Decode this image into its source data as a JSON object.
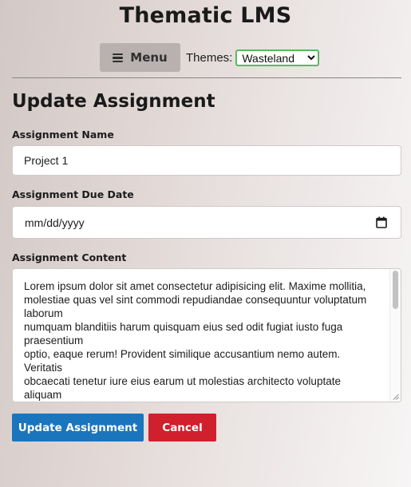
{
  "app": {
    "title": "Thematic LMS"
  },
  "nav": {
    "menu_label": "Menu",
    "menu_icon": "hamburger-icon",
    "themes_label": "Themes:",
    "themes_selected": "Wasteland",
    "themes_select_border_color": "#5cb85c"
  },
  "page": {
    "title": "Update Assignment"
  },
  "form": {
    "name_label": "Assignment Name",
    "name_value": "Project 1",
    "due_date_label": "Assignment Due Date",
    "due_date_placeholder": "mm/dd/yyyy",
    "due_date_icon": "calendar-icon",
    "content_label": "Assignment Content",
    "content_value": "Lorem ipsum dolor sit amet consectetur adipisicing elit. Maxime mollitia,\nmolestiae quas vel sint commodi repudiandae consequuntur voluptatum laborum\nnumquam blanditiis harum quisquam eius sed odit fugiat iusto fuga praesentium\noptio, eaque rerum! Provident similique accusantium nemo autem. Veritatis\nobcaecati tenetur iure eius earum ut molestias architecto voluptate aliquam"
  },
  "actions": {
    "update_label": "Update Assignment",
    "update_color": "#1a75bd",
    "cancel_label": "Cancel",
    "cancel_color": "#d01f2d"
  }
}
